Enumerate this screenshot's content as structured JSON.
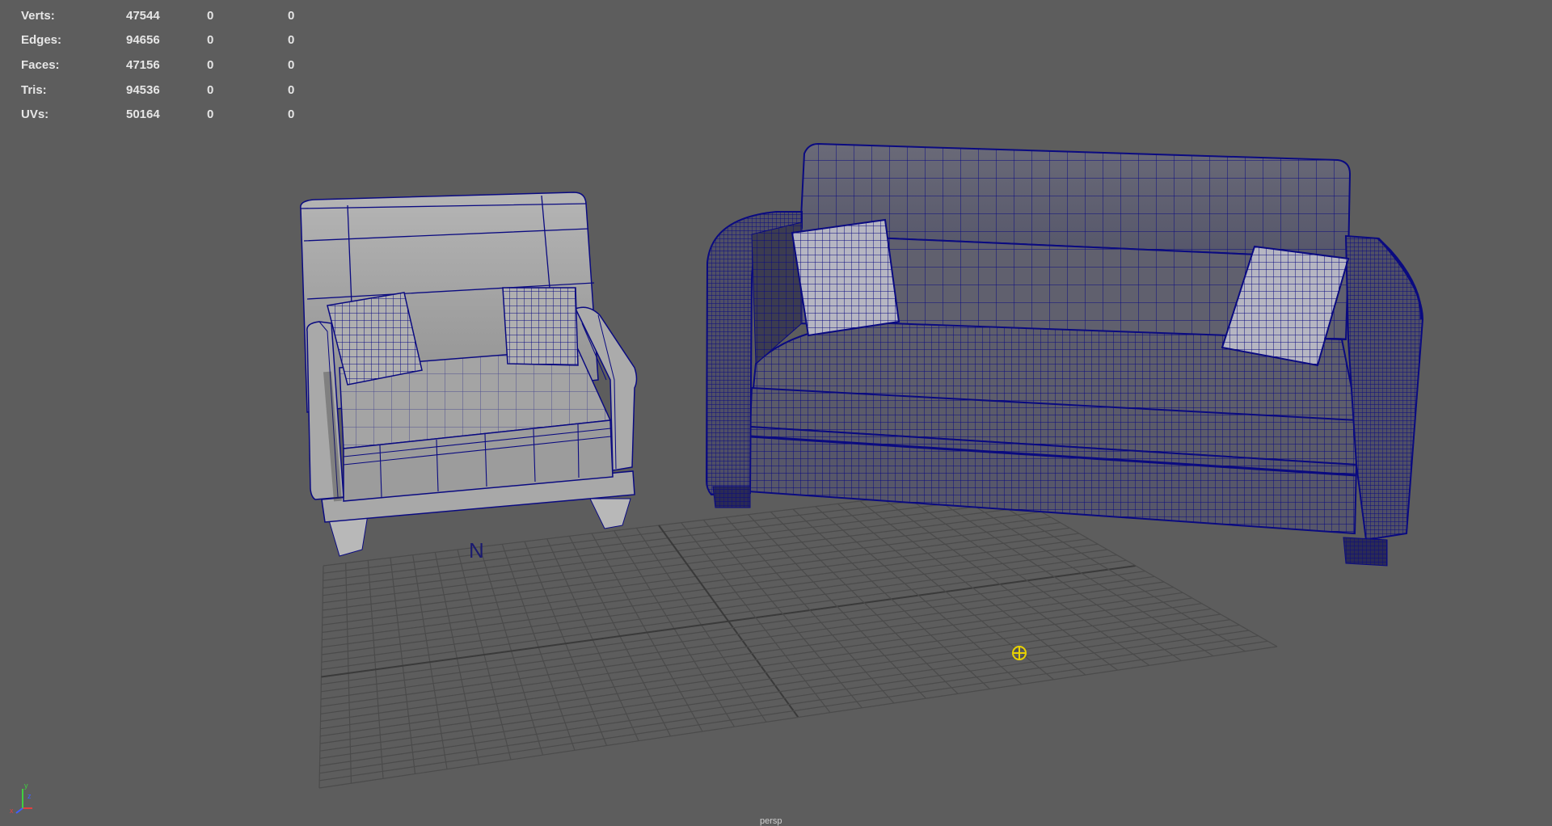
{
  "hud": {
    "rows": [
      {
        "label": "Verts:",
        "v1": "47544",
        "v2": "0",
        "v3": "0"
      },
      {
        "label": "Edges:",
        "v1": "94656",
        "v2": "0",
        "v3": "0"
      },
      {
        "label": "Faces:",
        "v1": "47156",
        "v2": "0",
        "v3": "0"
      },
      {
        "label": "Tris:",
        "v1": "94536",
        "v2": "0",
        "v3": "0"
      },
      {
        "label": "UVs:",
        "v1": "50164",
        "v2": "0",
        "v3": "0"
      }
    ]
  },
  "viewport": {
    "north_label": "N",
    "camera_label": "persp",
    "axis": {
      "x": "x",
      "y": "y",
      "z": "z"
    }
  },
  "colors": {
    "background": "#5d5d5d",
    "wireframe": "#0a0a80",
    "armchair_fill": "#a9a9a9",
    "sofa_fill": "#5f6070",
    "grid": "#4b4b4b",
    "pivot": "#e8d200"
  },
  "objects": [
    {
      "name": "armchair",
      "selected": false
    },
    {
      "name": "sofa",
      "selected": true
    }
  ]
}
